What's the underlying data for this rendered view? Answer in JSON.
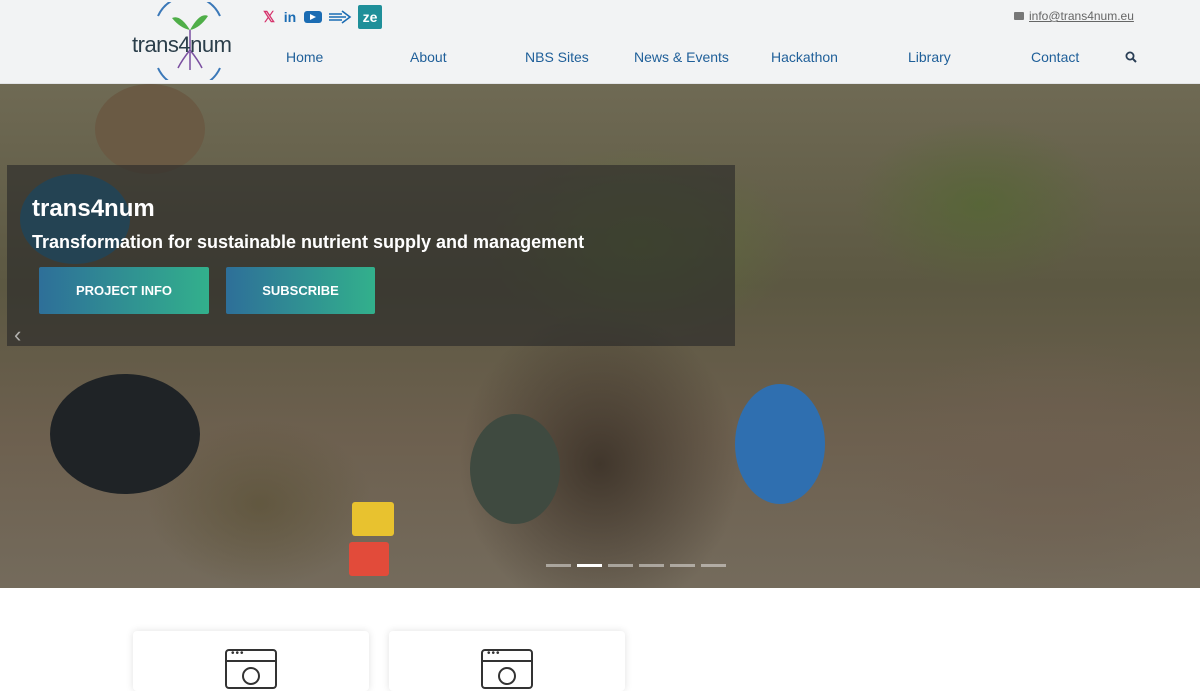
{
  "header": {
    "logo_text": "trans4num",
    "social": {
      "x_glyph": "𝕏",
      "linkedin_glyph": "in",
      "ze_glyph": "ze"
    },
    "email": "info@trans4num.eu",
    "nav": [
      {
        "label": "Home"
      },
      {
        "label": "About"
      },
      {
        "label": "NBS Sites"
      },
      {
        "label": "News & Events"
      },
      {
        "label": "Hackathon"
      },
      {
        "label": "Library"
      },
      {
        "label": "Contact"
      }
    ]
  },
  "hero": {
    "title": "trans4num",
    "subtitle": "Transformation for sustainable nutrient supply and management",
    "buttons": {
      "project_info": "Project Info",
      "subscribe": "Subscribe"
    },
    "slides_total": 6,
    "active_slide": 2
  },
  "colors": {
    "nav_link": "#1f5f99",
    "button_gradient_start": "#2e6f99",
    "button_gradient_end": "#32b08c",
    "ze_badge": "#1f8f99"
  },
  "icons": {
    "cards": [
      "browser-window-icon",
      "browser-window-icon"
    ]
  }
}
